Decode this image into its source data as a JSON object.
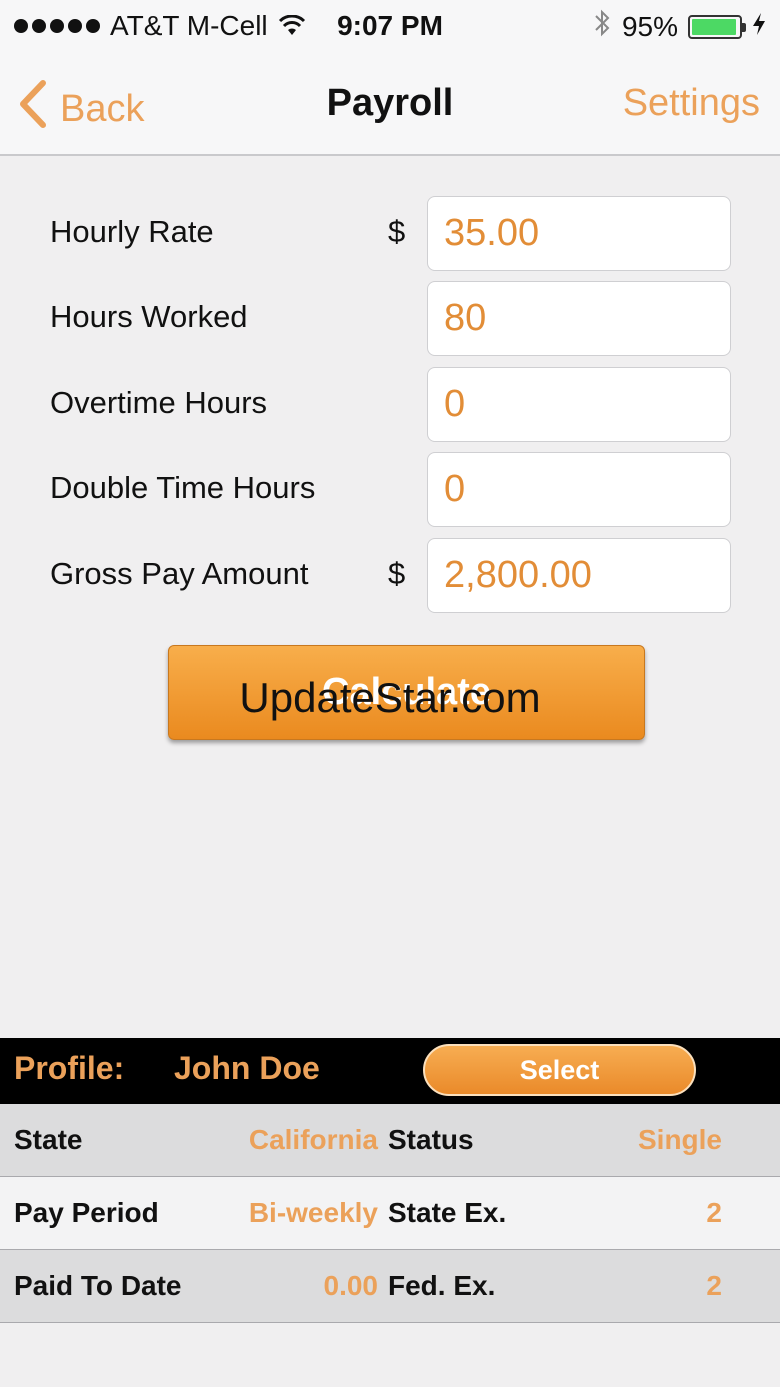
{
  "status_bar": {
    "carrier": "AT&T M-Cell",
    "time": "9:07 PM",
    "battery_percent": "95%",
    "battery_level": 0.95
  },
  "nav": {
    "back_label": "Back",
    "title": "Payroll",
    "settings_label": "Settings"
  },
  "form": {
    "currency_symbol": "$",
    "hourly_rate": {
      "label": "Hourly Rate",
      "value": "35.00"
    },
    "hours_worked": {
      "label": "Hours Worked",
      "value": "80"
    },
    "overtime_hours": {
      "label": "Overtime Hours",
      "value": "0"
    },
    "double_time_hours": {
      "label": "Double Time Hours",
      "value": "0"
    },
    "gross_pay": {
      "label": "Gross Pay Amount",
      "value": "2,800.00"
    }
  },
  "calculate_label": "Calculate",
  "watermark": "UpdateStar.com",
  "profile": {
    "label": "Profile:",
    "name": "John Doe",
    "select_label": "Select"
  },
  "info": {
    "rows": [
      {
        "k1": "State",
        "v1": "California",
        "k2": "Status",
        "v2": "Single"
      },
      {
        "k1": "Pay Period",
        "v1": "Bi-weekly",
        "k2": "State Ex.",
        "v2": "2"
      },
      {
        "k1": "Paid To Date",
        "v1": "0.00",
        "k2": "Fed. Ex.",
        "v2": "2"
      }
    ]
  },
  "colors": {
    "accent": "#eba15a",
    "value_text": "#e28d37",
    "button_top": "#f8ae4b",
    "button_bottom": "#ea8a1f"
  }
}
